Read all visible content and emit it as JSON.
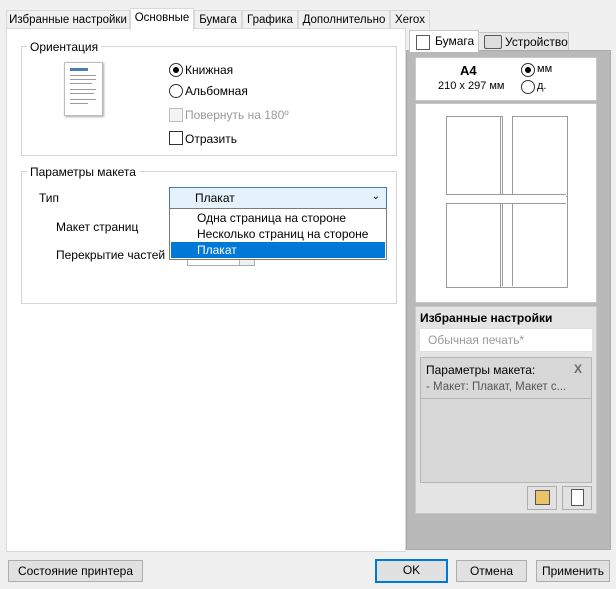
{
  "tabs": [
    {
      "label": "Избранные настройки"
    },
    {
      "label": "Основные"
    },
    {
      "label": "Бумага"
    },
    {
      "label": "Графика"
    },
    {
      "label": "Дополнительно"
    },
    {
      "label": "Xerox"
    }
  ],
  "orientation": {
    "title": "Ориентация",
    "portrait": "Книжная",
    "landscape": "Альбомная",
    "rotate": "Повернуть на 180º",
    "mirror": "Отразить"
  },
  "layout": {
    "title": "Параметры макета",
    "type_label": "Тип",
    "type_value": "Плакат",
    "pages_label": "Макет страниц",
    "overlap_label": "Перекрытие частей",
    "options": [
      "Одна страница на стороне",
      "Несколько страниц на стороне",
      "Плакат"
    ]
  },
  "right_tabs": {
    "paper": "Бумага",
    "device": "Устройство"
  },
  "paper": {
    "size": "A4",
    "dims": "210 x 297 мм",
    "unit_mm": "мм",
    "unit_in": "д."
  },
  "favorites": {
    "title": "Избранные настройки",
    "placeholder": "Обычная печать*",
    "detail_title": "Параметры макета:",
    "detail_value": "- Макет: Плакат, Макет с...",
    "close": "X"
  },
  "buttons": {
    "status": "Состояние принтера",
    "ok": "OK",
    "cancel": "Отмена",
    "apply": "Применить"
  }
}
